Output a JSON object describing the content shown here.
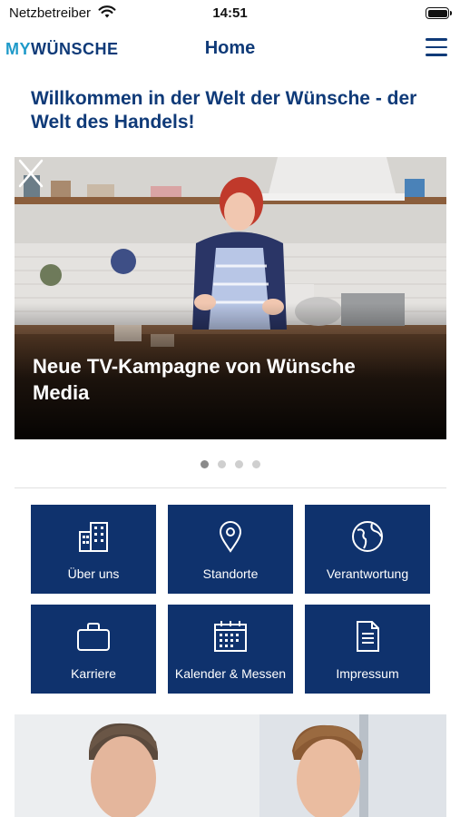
{
  "status_bar": {
    "carrier": "Netzbetreiber",
    "time": "14:51"
  },
  "nav": {
    "logo_my": "MY",
    "logo_brand": "WÜNSCHE",
    "title": "Home",
    "menu_icon": "hamburger-menu-icon"
  },
  "welcome": {
    "headline": "Willkommen in der Welt der Wünsche - der Welt des Handels!"
  },
  "carousel": {
    "caption": "Neue TV-Kampagne von Wünsche Media",
    "slide_count": 4,
    "active_slide": 1
  },
  "tiles": [
    {
      "label": "Über uns",
      "icon": "building-icon"
    },
    {
      "label": "Standorte",
      "icon": "location-pin-icon"
    },
    {
      "label": "Verantwortung",
      "icon": "globe-icon"
    },
    {
      "label": "Karriere",
      "icon": "briefcase-icon"
    },
    {
      "label": "Kalender & Messen",
      "icon": "calendar-icon"
    },
    {
      "label": "Impressum",
      "icon": "document-icon"
    }
  ],
  "colors": {
    "brand_blue": "#0f3a78",
    "tile_blue": "#0f326d",
    "logo_accent": "#1f9ac9"
  }
}
